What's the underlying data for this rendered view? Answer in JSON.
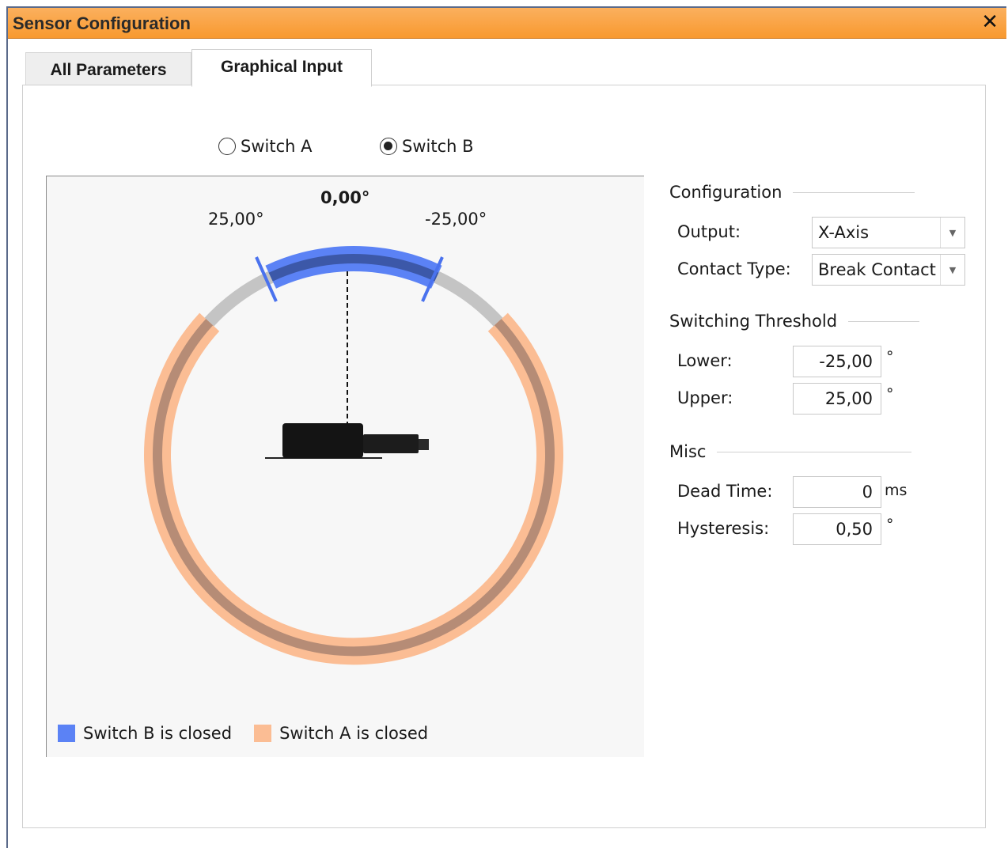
{
  "window": {
    "title": "Sensor Configuration",
    "close_glyph": "✕"
  },
  "tabs": [
    {
      "label": "All Parameters",
      "active": false
    },
    {
      "label": "Graphical Input",
      "active": true
    }
  ],
  "switch_select": {
    "options": [
      {
        "label": "Switch A",
        "checked": false
      },
      {
        "label": "Switch B",
        "checked": true
      }
    ]
  },
  "graph": {
    "current_angle": "0,00°",
    "left_limit": "25,00°",
    "right_limit": "-25,00°",
    "legend": [
      {
        "label": "Switch B is closed",
        "color": "#5b82f5"
      },
      {
        "label": "Switch A is closed",
        "color": "#fbbd94"
      }
    ]
  },
  "configuration": {
    "heading": "Configuration",
    "output_label": "Output:",
    "output_value": "X-Axis",
    "contact_label": "Contact Type:",
    "contact_value": "Break Contact"
  },
  "threshold": {
    "heading": "Switching Threshold",
    "lower_label": "Lower:",
    "lower_value": "-25,00",
    "lower_unit": "°",
    "upper_label": "Upper:",
    "upper_value": "25,00",
    "upper_unit": "°"
  },
  "misc": {
    "heading": "Misc",
    "dead_time_label": "Dead Time:",
    "dead_time_value": "0",
    "dead_time_unit": "ms",
    "hysteresis_label": "Hysteresis:",
    "hysteresis_value": "0,50",
    "hysteresis_unit": "°"
  },
  "colors": {
    "titlebar": "#f8992f",
    "switch_b": "#5b82f5",
    "switch_a": "#fbbd94"
  }
}
